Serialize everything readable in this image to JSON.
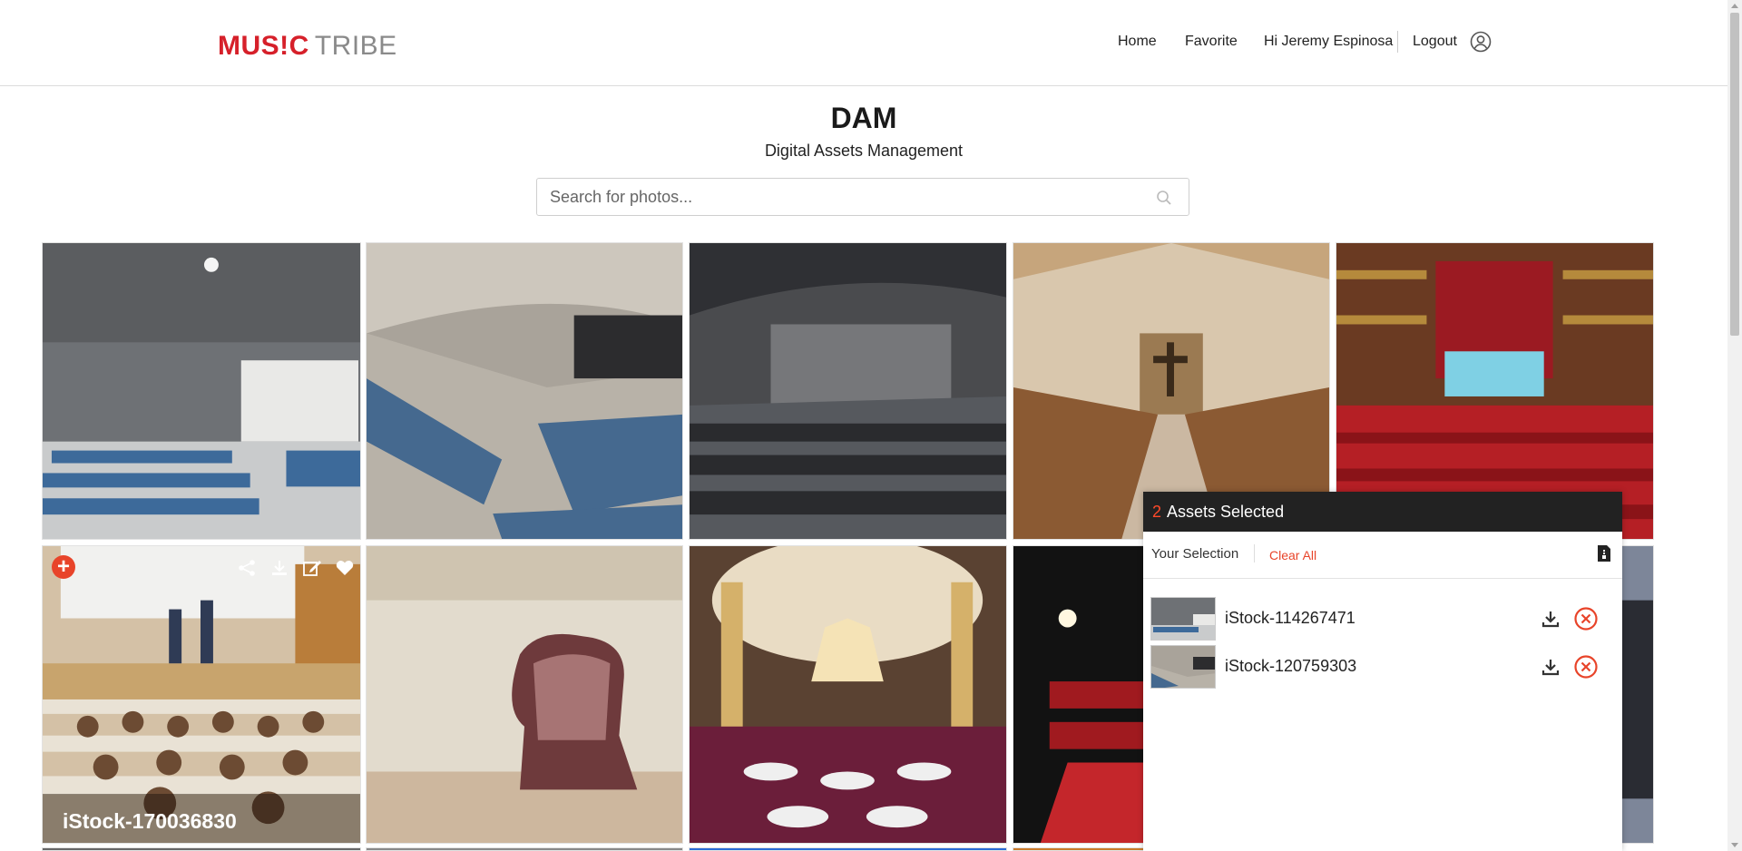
{
  "header": {
    "logo_part1": "MUS!C",
    "logo_part2": "TRIBE",
    "nav": {
      "home": "Home",
      "favorite": "Favorite",
      "greeting": "Hi Jeremy Espinosa",
      "logout": "Logout"
    },
    "user_icon": "user-circle-icon"
  },
  "hero": {
    "title": "DAM",
    "subtitle": "Digital Assets Management"
  },
  "search": {
    "placeholder": "Search for photos...",
    "icon": "search-icon"
  },
  "grid": {
    "hovered_tile": {
      "caption": "iStock-170036830",
      "add_badge": "+",
      "actions": [
        "share-icon",
        "download-icon",
        "edit-icon",
        "heart-icon"
      ]
    }
  },
  "selection_panel": {
    "count": "2",
    "heading": "Assets Selected",
    "your_selection": "Your Selection",
    "clear_all": "Clear All",
    "items": [
      {
        "name": "iStock-114267471"
      },
      {
        "name": "iStock-120759303"
      }
    ]
  },
  "colors": {
    "brand_red": "#d6202a",
    "accent_orange": "#e8442a",
    "panel_header": "#222222"
  }
}
